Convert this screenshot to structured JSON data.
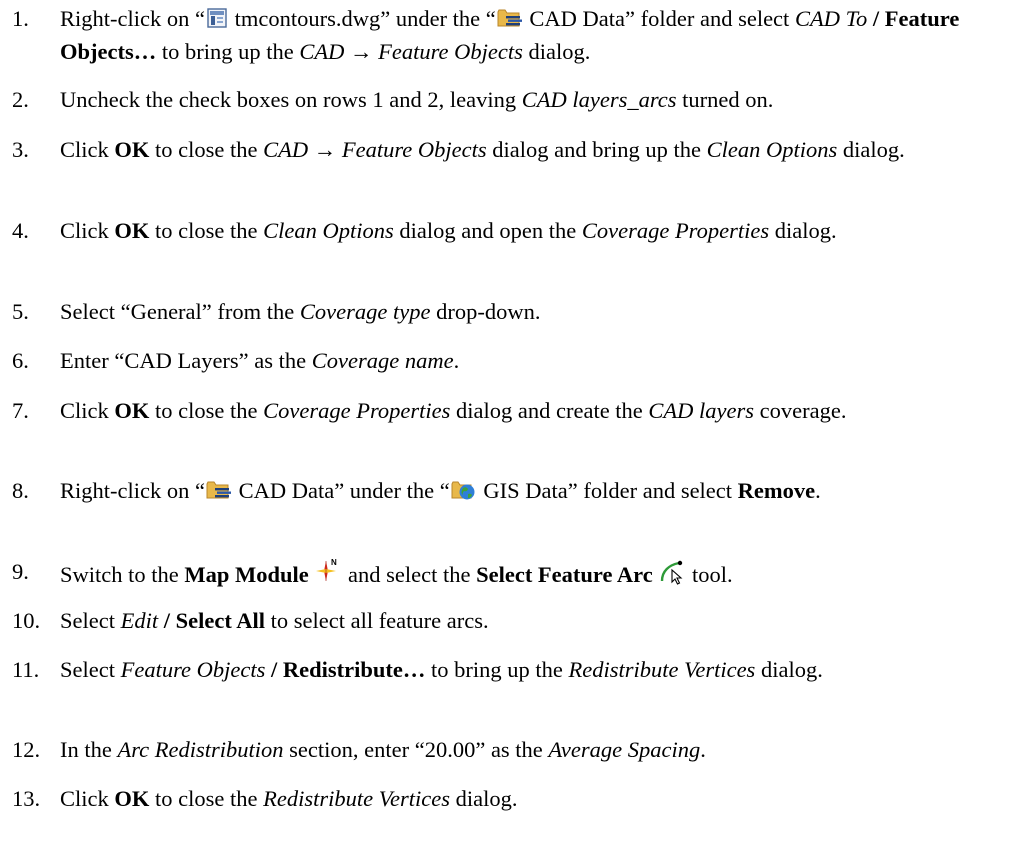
{
  "steps": [
    {
      "num": "1.",
      "parts": [
        {
          "t": "Right-click on “"
        },
        {
          "icon": "dwg-file-icon"
        },
        {
          "t": " tmcontours.dwg” under the “"
        },
        {
          "icon": "cad-folder-icon"
        },
        {
          "t": " CAD Data” folder and select "
        },
        {
          "t": "CAD To",
          "s": "i"
        },
        {
          "t": " / ",
          "s": "b"
        },
        {
          "t": "Feature Objects…",
          "s": "b"
        },
        {
          "t": " to bring up the "
        },
        {
          "t": "CAD → Feature Objects",
          "s": "i"
        },
        {
          "t": " dialog."
        }
      ]
    },
    {
      "num": "2.",
      "parts": [
        {
          "t": "Uncheck the check boxes on rows 1 and 2, leaving "
        },
        {
          "t": "CAD layers_arcs",
          "s": "i"
        },
        {
          "t": " turned on."
        }
      ]
    },
    {
      "num": "3.",
      "parts": [
        {
          "t": "Click "
        },
        {
          "t": "OK",
          "s": "b"
        },
        {
          "t": " to close the "
        },
        {
          "t": "CAD → Feature Objects",
          "s": "i"
        },
        {
          "t": " dialog and bring up the "
        },
        {
          "t": "Clean Options",
          "s": "i"
        },
        {
          "t": " dialog."
        }
      ]
    },
    {
      "num": "4.",
      "parts": [
        {
          "t": "Click "
        },
        {
          "t": "OK",
          "s": "b"
        },
        {
          "t": " to close the "
        },
        {
          "t": "Clean Options",
          "s": "i"
        },
        {
          "t": " dialog and open the "
        },
        {
          "t": "Coverage Properties",
          "s": "i"
        },
        {
          "t": " dialog."
        }
      ]
    },
    {
      "num": "5.",
      "parts": [
        {
          "t": "Select “General” from the "
        },
        {
          "t": "Coverage type",
          "s": "i"
        },
        {
          "t": " drop-down."
        }
      ]
    },
    {
      "num": "6.",
      "parts": [
        {
          "t": "Enter “CAD Layers” as the "
        },
        {
          "t": "Coverage name",
          "s": "i"
        },
        {
          "t": "."
        }
      ]
    },
    {
      "num": "7.",
      "parts": [
        {
          "t": "Click "
        },
        {
          "t": "OK",
          "s": "b"
        },
        {
          "t": " to close the "
        },
        {
          "t": "Coverage Properties",
          "s": "i"
        },
        {
          "t": " dialog and create the "
        },
        {
          "t": "CAD layers",
          "s": "i"
        },
        {
          "t": " coverage."
        }
      ]
    },
    {
      "num": "8.",
      "parts": [
        {
          "t": "Right-click on “"
        },
        {
          "icon": "cad-folder-icon"
        },
        {
          "t": " CAD Data” under the “"
        },
        {
          "icon": "gis-folder-icon"
        },
        {
          "t": " GIS Data” folder and select "
        },
        {
          "t": "Remove",
          "s": "b"
        },
        {
          "t": "."
        }
      ]
    },
    {
      "num": "9.",
      "parts": [
        {
          "t": "Switch to the "
        },
        {
          "t": "Map Module",
          "s": "b"
        },
        {
          "t": " "
        },
        {
          "icon": "map-module-icon"
        },
        {
          "t": " and select the "
        },
        {
          "t": "Select Feature Arc",
          "s": "b"
        },
        {
          "t": " "
        },
        {
          "icon": "select-arc-icon"
        },
        {
          "t": " tool."
        }
      ]
    },
    {
      "num": "10.",
      "parts": [
        {
          "t": "Select "
        },
        {
          "t": "Edit",
          "s": "i"
        },
        {
          "t": " / ",
          "s": "b"
        },
        {
          "t": "Select All",
          "s": "b"
        },
        {
          "t": " to select all feature arcs."
        }
      ]
    },
    {
      "num": "11.",
      "parts": [
        {
          "t": "Select "
        },
        {
          "t": "Feature Objects",
          "s": "i"
        },
        {
          "t": " / ",
          "s": "b"
        },
        {
          "t": "Redistribute…",
          "s": "b"
        },
        {
          "t": " to bring up the "
        },
        {
          "t": "Redistribute Vertices",
          "s": "i"
        },
        {
          "t": " dialog."
        }
      ]
    },
    {
      "num": "12.",
      "parts": [
        {
          "t": "In the "
        },
        {
          "t": "Arc Redistribution",
          "s": "i"
        },
        {
          "t": " section, enter “20.00” as the "
        },
        {
          "t": "Average Spacing",
          "s": "i"
        },
        {
          "t": "."
        }
      ]
    },
    {
      "num": "13.",
      "parts": [
        {
          "t": "Click "
        },
        {
          "t": "OK",
          "s": "b"
        },
        {
          "t": " to close the "
        },
        {
          "t": "Redistribute Vertices",
          "s": "i"
        },
        {
          "t": " dialog."
        }
      ]
    }
  ],
  "colors": {
    "folder": "#e8b84a",
    "folder_dark": "#b8862a",
    "globe_blue": "#2f7fd8",
    "globe_green": "#3fa33a",
    "compass_red": "#e0301e",
    "compass_yellow": "#f4c020",
    "arc_green": "#2e9a38"
  }
}
